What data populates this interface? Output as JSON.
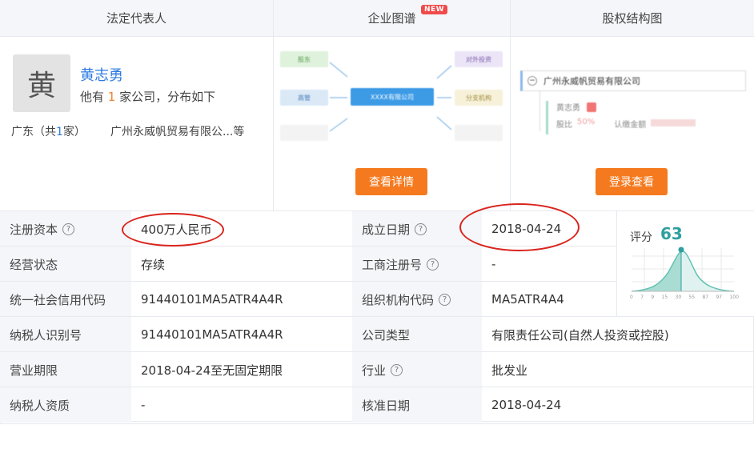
{
  "panels": {
    "legal_rep": {
      "title": "法定代表人",
      "avatar_char": "黄",
      "name": "黄志勇",
      "summary_prefix": "他有",
      "summary_count": "1",
      "summary_suffix": "家公司，分布如下",
      "region_prefix": "广东（共",
      "region_count": "1",
      "region_suffix": "家）",
      "region_company": "广州永威帆贸易有限公...等"
    },
    "enterprise_graph": {
      "title": "企业图谱",
      "badge": "NEW",
      "nodes": {
        "shareholder": "股东",
        "executive": "高管",
        "company": "XXXX有限公司",
        "investment": "对外投资",
        "branch": "分支机构"
      },
      "button": "查看详情"
    },
    "equity": {
      "title": "股权结构图",
      "company": "广州永威帆贸易有限公司",
      "person": "黄志勇",
      "share_label": "股比",
      "share_value": "50%",
      "subscribe_label": "认缴金额",
      "button": "登录查看"
    }
  },
  "table": {
    "rows": [
      {
        "l1": "注册资本",
        "v1": "400万人民币",
        "l2": "成立日期",
        "v2": "2018-04-24"
      },
      {
        "l1": "经营状态",
        "v1": "存续",
        "l2": "工商注册号",
        "v2": "-"
      },
      {
        "l1": "统一社会信用代码",
        "v1": "91440101MA5ATR4A4R",
        "l2": "组织机构代码",
        "v2": "MA5ATR4A4"
      },
      {
        "l1": "纳税人识别号",
        "v1": "91440101MA5ATR4A4R",
        "l2": "公司类型",
        "v2": "有限责任公司(自然人投资或控股)"
      },
      {
        "l1": "营业期限",
        "v1": "2018-04-24至无固定期限",
        "l2": "行业",
        "v2": "批发业"
      },
      {
        "l1": "纳税人资质",
        "v1": "-",
        "l2": "核准日期",
        "v2": "2018-04-24"
      }
    ]
  },
  "score": {
    "label": "评分",
    "value": "63",
    "ticks": [
      "0",
      "7",
      "9",
      "15",
      "30",
      "55",
      "87",
      "97",
      "100"
    ]
  },
  "colors": {
    "accent_blue": "#2d7be0",
    "orange_button": "#f57a1f",
    "annotation_red": "#d9241c",
    "score_teal": "#2f9fa0"
  }
}
